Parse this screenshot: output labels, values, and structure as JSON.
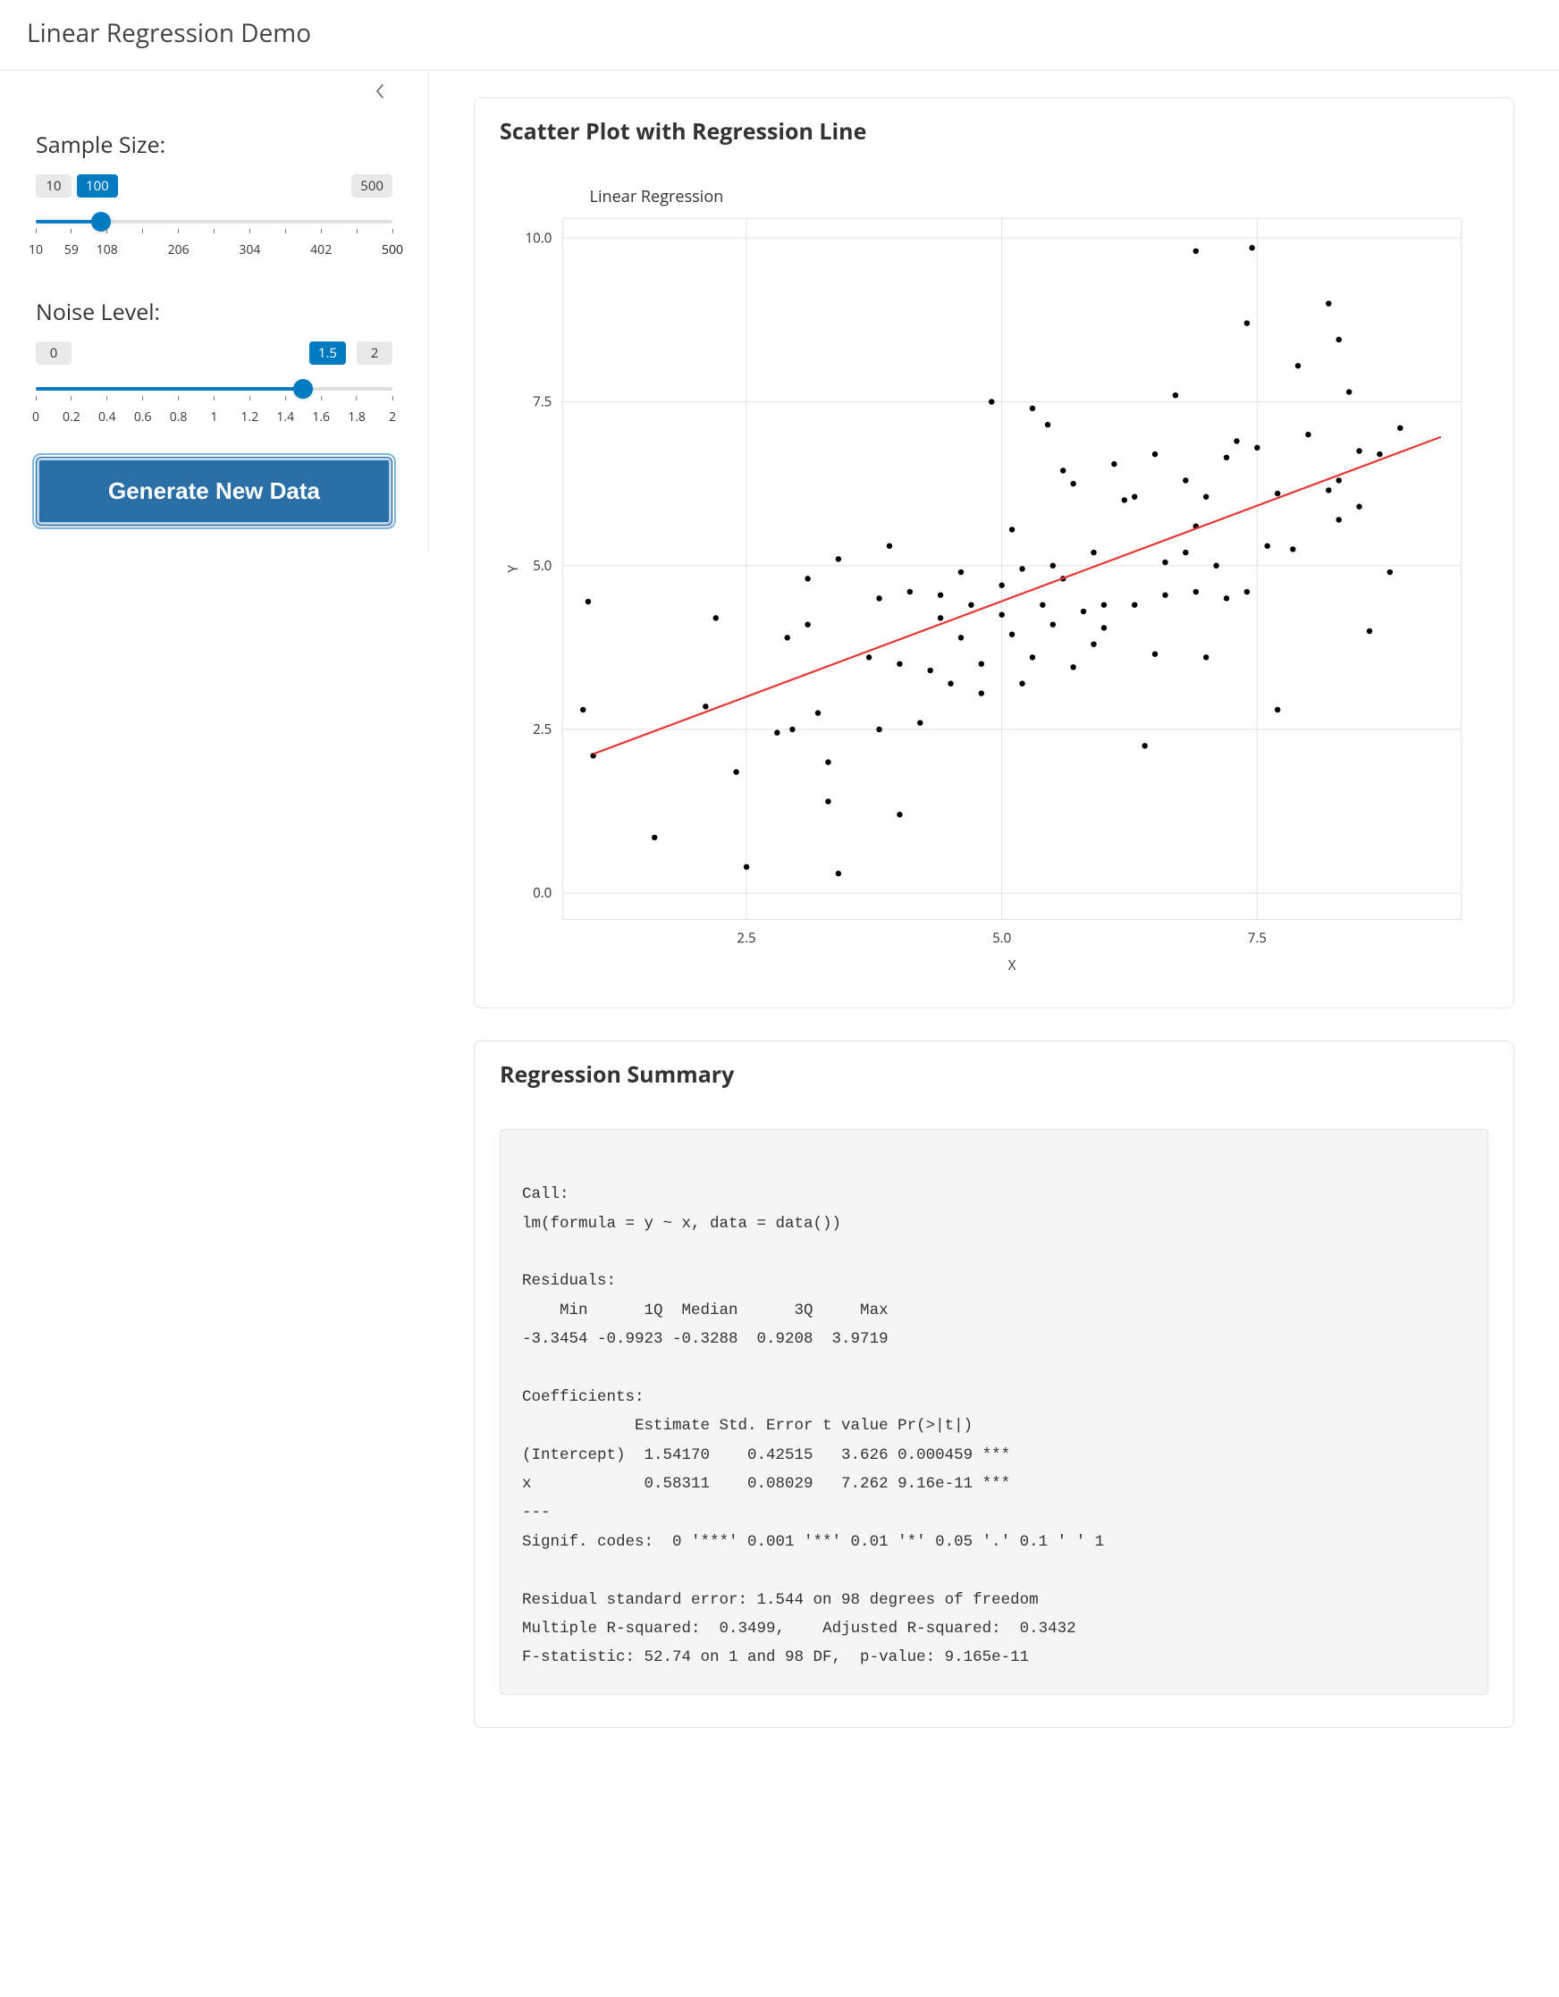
{
  "header": {
    "title": "Linear Regression Demo"
  },
  "sidebar": {
    "collapse_icon": "chevron-left",
    "sample_size": {
      "label": "Sample Size:",
      "min": 10,
      "max": 500,
      "value": 100,
      "min_display": "10",
      "value_display": "100",
      "max_display": "500",
      "axis_ticks_minor": [
        59,
        108,
        157,
        206,
        255,
        304,
        353,
        402,
        451
      ],
      "axis_ticks_labeled": [
        10,
        59,
        108,
        206,
        304,
        402,
        500
      ]
    },
    "noise": {
      "label": "Noise Level:",
      "min": 0,
      "max": 2,
      "value": 1.5,
      "min_display": "0",
      "value_display": "1.5",
      "max_display": "2",
      "axis_ticks": [
        0,
        0.2,
        0.4,
        0.6,
        0.8,
        1,
        1.2,
        1.4,
        1.6,
        1.8,
        2
      ]
    },
    "button": "Generate New Data"
  },
  "chart_panel": {
    "title": "Scatter Plot with Regression Line"
  },
  "summary_panel": {
    "title": "Regression Summary",
    "text": "\nCall:\nlm(formula = y ~ x, data = data())\n\nResiduals:\n    Min      1Q  Median      3Q     Max \n-3.3454 -0.9923 -0.3288  0.9208  3.9719 \n\nCoefficients:\n            Estimate Std. Error t value Pr(>|t|)    \n(Intercept)  1.54170    0.42515   3.626 0.000459 ***\nx            0.58311    0.08029   7.262 9.16e-11 ***\n---\nSignif. codes:  0 '***' 0.001 '**' 0.01 '*' 0.05 '.' 0.1 ' ' 1\n\nResidual standard error: 1.544 on 98 degrees of freedom\nMultiple R-squared:  0.3499,\tAdjusted R-squared:  0.3432 \nF-statistic: 52.74 on 1 and 98 DF,  p-value: 9.165e-11\n"
  },
  "chart_data": {
    "type": "scatter",
    "title": "Linear Regression",
    "xlabel": "X",
    "ylabel": "Y",
    "xlim": [
      0.7,
      9.5
    ],
    "ylim": [
      -0.4,
      10.3
    ],
    "x_ticks": [
      2.5,
      5.0,
      7.5
    ],
    "y_ticks": [
      0.0,
      2.5,
      5.0,
      7.5,
      10.0
    ],
    "series": [
      {
        "name": "points",
        "kind": "points",
        "points": [
          [
            1.0,
            2.1
          ],
          [
            2.2,
            4.2
          ],
          [
            0.9,
            2.8
          ],
          [
            2.5,
            0.4
          ],
          [
            1.6,
            0.85
          ],
          [
            2.8,
            2.45
          ],
          [
            2.4,
            1.85
          ],
          [
            2.1,
            2.85
          ],
          [
            3.1,
            4.1
          ],
          [
            3.1,
            4.8
          ],
          [
            2.9,
            3.9
          ],
          [
            2.95,
            2.5
          ],
          [
            3.2,
            2.75
          ],
          [
            3.4,
            0.3
          ],
          [
            3.3,
            1.4
          ],
          [
            3.3,
            2.0
          ],
          [
            3.4,
            5.1
          ],
          [
            3.8,
            2.5
          ],
          [
            3.7,
            3.6
          ],
          [
            3.8,
            4.5
          ],
          [
            4.0,
            3.5
          ],
          [
            4.1,
            4.6
          ],
          [
            3.9,
            5.3
          ],
          [
            4.0,
            1.2
          ],
          [
            4.3,
            3.4
          ],
          [
            4.4,
            4.2
          ],
          [
            4.4,
            4.55
          ],
          [
            4.6,
            3.9
          ],
          [
            4.5,
            3.2
          ],
          [
            4.7,
            4.4
          ],
          [
            4.6,
            4.9
          ],
          [
            5.0,
            4.25
          ],
          [
            4.8,
            3.5
          ],
          [
            4.9,
            7.5
          ],
          [
            5.0,
            4.7
          ],
          [
            4.8,
            3.05
          ],
          [
            5.1,
            3.95
          ],
          [
            5.2,
            3.2
          ],
          [
            5.3,
            7.4
          ],
          [
            5.2,
            4.95
          ],
          [
            5.3,
            3.6
          ],
          [
            5.45,
            7.15
          ],
          [
            5.4,
            4.4
          ],
          [
            5.6,
            6.45
          ],
          [
            5.5,
            5.0
          ],
          [
            5.5,
            4.1
          ],
          [
            5.6,
            4.8
          ],
          [
            5.7,
            6.25
          ],
          [
            5.7,
            3.45
          ],
          [
            5.8,
            4.3
          ],
          [
            5.9,
            3.8
          ],
          [
            6.0,
            4.4
          ],
          [
            5.9,
            5.2
          ],
          [
            6.1,
            6.55
          ],
          [
            6.2,
            6.0
          ],
          [
            6.0,
            4.05
          ],
          [
            6.3,
            6.05
          ],
          [
            6.4,
            2.25
          ],
          [
            6.3,
            4.4
          ],
          [
            6.5,
            3.65
          ],
          [
            6.5,
            6.7
          ],
          [
            6.6,
            5.05
          ],
          [
            6.7,
            7.6
          ],
          [
            6.6,
            4.55
          ],
          [
            6.8,
            6.3
          ],
          [
            6.8,
            5.2
          ],
          [
            7.0,
            6.05
          ],
          [
            6.9,
            4.6
          ],
          [
            6.9,
            9.8
          ],
          [
            6.9,
            5.6
          ],
          [
            7.2,
            6.65
          ],
          [
            7.1,
            5.0
          ],
          [
            7.2,
            4.5
          ],
          [
            7.3,
            6.9
          ],
          [
            7.4,
            8.7
          ],
          [
            7.45,
            9.85
          ],
          [
            7.5,
            6.8
          ],
          [
            7.6,
            5.3
          ],
          [
            7.7,
            2.8
          ],
          [
            7.7,
            6.1
          ],
          [
            7.85,
            5.25
          ],
          [
            7.9,
            8.05
          ],
          [
            8.0,
            7.0
          ],
          [
            8.2,
            6.15
          ],
          [
            8.2,
            9.0
          ],
          [
            8.3,
            8.45
          ],
          [
            8.3,
            5.7
          ],
          [
            8.3,
            6.3
          ],
          [
            8.4,
            7.65
          ],
          [
            8.5,
            6.75
          ],
          [
            8.5,
            5.9
          ],
          [
            8.7,
            6.7
          ],
          [
            8.8,
            4.9
          ],
          [
            8.9,
            7.1
          ],
          [
            8.6,
            4.0
          ],
          [
            7.0,
            3.6
          ],
          [
            7.4,
            4.6
          ],
          [
            5.1,
            5.55
          ],
          [
            4.2,
            2.6
          ],
          [
            0.95,
            4.45
          ]
        ]
      },
      {
        "name": "fit",
        "kind": "line",
        "intercept": 1.5417,
        "slope": 0.58311,
        "x_from": 1.0,
        "x_to": 9.3
      }
    ]
  }
}
